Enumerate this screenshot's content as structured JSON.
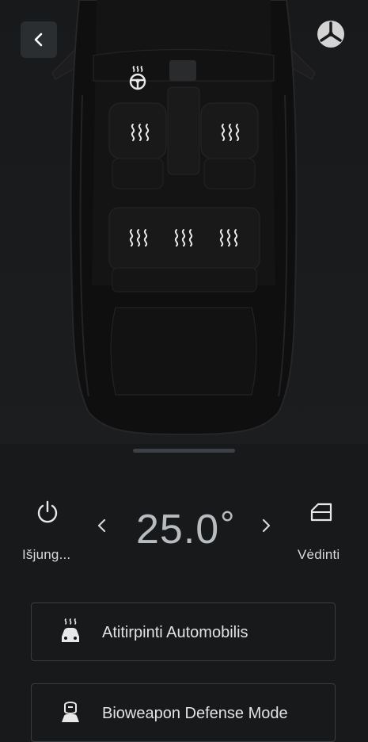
{
  "header": {
    "back_icon": "chevron-left-icon",
    "logo_icon": "brand-logo-icon"
  },
  "cabin": {
    "steering_wheel_heat_icon": "steering-wheel-heat-icon",
    "seats": [
      {
        "name": "front-left",
        "icon": "seat-heat-icon"
      },
      {
        "name": "front-right",
        "icon": "seat-heat-icon"
      },
      {
        "name": "rear-left",
        "icon": "seat-heat-icon"
      },
      {
        "name": "rear-center",
        "icon": "seat-heat-icon"
      },
      {
        "name": "rear-right",
        "icon": "seat-heat-icon"
      }
    ]
  },
  "climate": {
    "power_label": "Išjung...",
    "temperature": "25.0",
    "unit": "°",
    "vent_label": "Vėdinti"
  },
  "actions": [
    {
      "label": "Atitirpinti Automobilis",
      "icon": "defrost-car-icon"
    },
    {
      "label": "Bioweapon Defense Mode",
      "icon": "bioweapon-icon"
    }
  ],
  "colors": {
    "background": "#17191b",
    "card_border": "#3a3d40",
    "icon": "#e8e8e8"
  }
}
